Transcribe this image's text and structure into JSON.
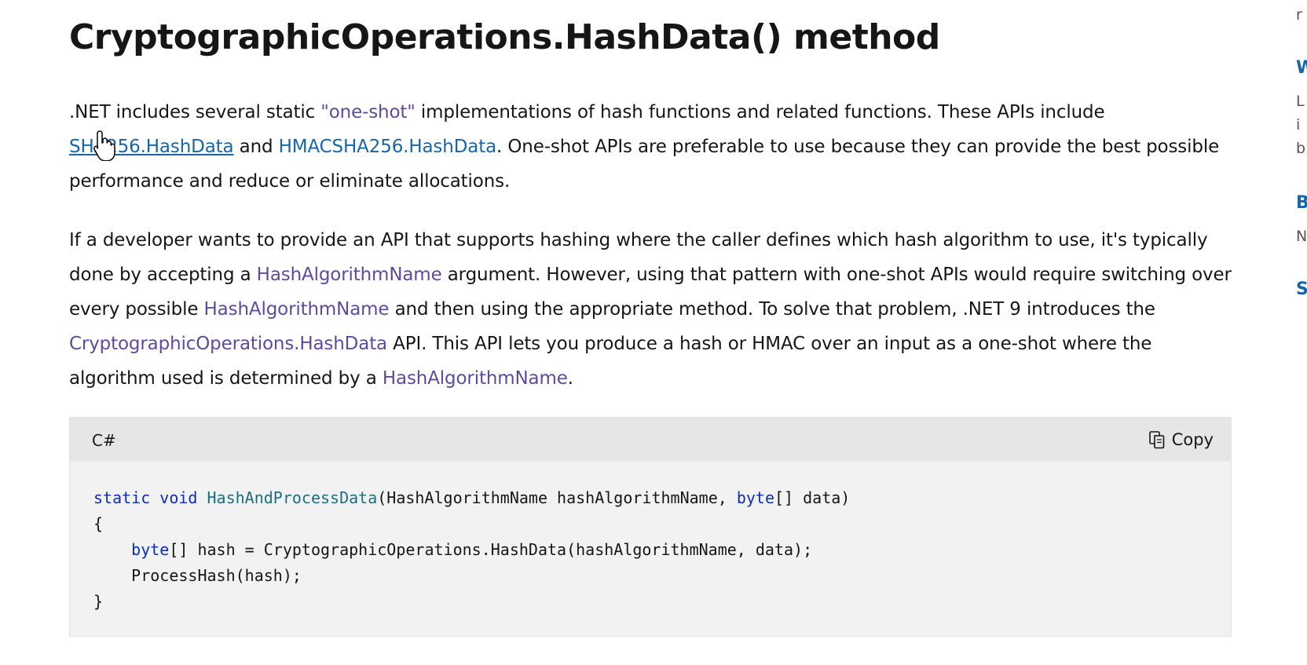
{
  "title": "CryptographicOperations.HashData() method",
  "para1": {
    "t1": ".NET includes several static ",
    "one_shot_link": "\"one-shot\"",
    "t2": " implementations of hash functions and related functions. These APIs include ",
    "sha_link": "SHA256.HashData",
    "t3": " and ",
    "hmac_link": "HMACSHA256.HashData",
    "t4": ". One-shot APIs are preferable to use because they can provide the best possible performance and reduce or eliminate allocations."
  },
  "para2": {
    "t1": "If a developer wants to provide an API that supports hashing where the caller defines which hash algorithm to use, it's typically done by accepting a ",
    "link1": "HashAlgorithmName",
    "t2": " argument. However, using that pattern with one-shot APIs would require switching over every possible ",
    "link2": "HashAlgorithmName",
    "t3": " and then using the appropriate method. To solve that problem, .NET 9 introduces the ",
    "link3": "CryptographicOperations.HashData",
    "t4": " API. This API lets you produce a hash or HMAC over an input as a one-shot where the algorithm used is determined by a ",
    "link4": "HashAlgorithmName",
    "t5": "."
  },
  "code": {
    "language": "C#",
    "copy_label": "Copy",
    "line1": {
      "kw_static": "static",
      "kw_void": "void",
      "fn_name": "HashAndProcessData",
      "params_a": "(HashAlgorithmName hashAlgorithmName, ",
      "kw_byte": "byte",
      "params_b": "[] data)"
    },
    "line2": "{",
    "line3": {
      "kw_byte": "byte",
      "rest": "[] hash = CryptographicOperations.HashData(hashAlgorithmName, data);"
    },
    "line4": "ProcessHash(hash);",
    "line5": "}"
  },
  "right_rail": {
    "frag1": "r",
    "frag2": "W",
    "frag3": "L",
    "frag4": "i",
    "frag5": "b",
    "frag6": "B",
    "frag7": "N",
    "frag8": "S"
  },
  "colors": {
    "link_visited": "#5e4a9e",
    "link": "#1866a8",
    "keyword": "#0b2fb8",
    "type_name": "#1a6e86",
    "code_bg": "#f2f2f2",
    "code_header_bg": "#e6e6e6"
  },
  "icons": [
    "copy-icon",
    "hand-cursor-icon"
  ]
}
